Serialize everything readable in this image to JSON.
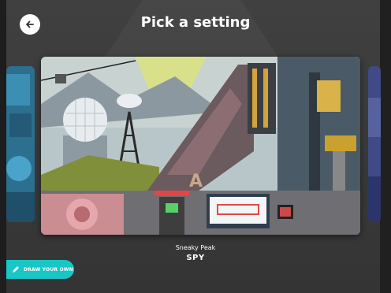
{
  "header": {
    "title": "Pick a setting",
    "back_icon": "arrow-left-icon"
  },
  "carousel": {
    "selected": {
      "subtitle": "Sneaky Peak",
      "name": "SPY"
    },
    "scene_sign": "A",
    "cards": [
      "previous-setting",
      "sneaky-peak-spy",
      "next-setting"
    ]
  },
  "draw_button": {
    "label": "DRAW YOUR OWN",
    "icon": "pencil-icon"
  },
  "colors": {
    "accent": "#19c6c6",
    "background": "#3a3a3a"
  }
}
